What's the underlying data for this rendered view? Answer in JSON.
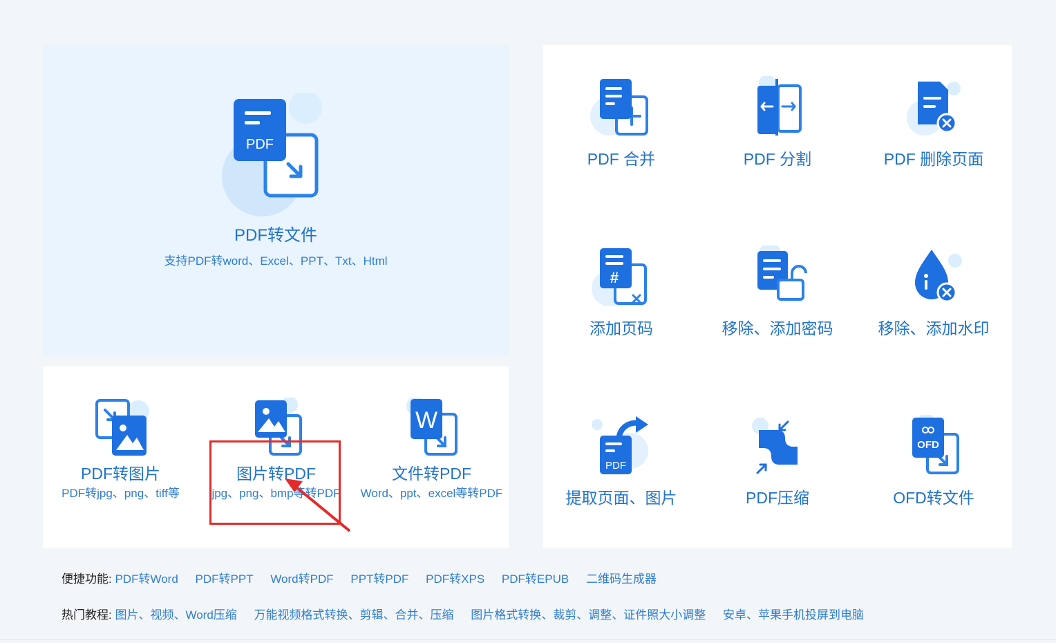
{
  "hero": {
    "icon": "pdf-convert-icon",
    "icon_text": "PDF",
    "title": "PDF转文件",
    "desc": "支持PDF转word、Excel、PPT、Txt、Html"
  },
  "left_tools": [
    {
      "label": "PDF转图片",
      "desc": "PDF转jpg、png、tiff等",
      "icon": "pdf-to-image-icon"
    },
    {
      "label": "图片转PDF",
      "desc": "jpg、png、bmp等转PDF",
      "icon": "image-to-pdf-icon"
    },
    {
      "label": "文件转PDF",
      "desc": "Word、ppt、excel等转PDF",
      "icon": "word-to-pdf-icon",
      "icon_text": "W"
    }
  ],
  "right_tools": [
    {
      "label": "PDF 合并",
      "icon": "pdf-merge-icon"
    },
    {
      "label": "PDF 分割",
      "icon": "pdf-split-icon"
    },
    {
      "label": "PDF 删除页面",
      "icon": "pdf-delete-page-icon"
    },
    {
      "label": "添加页码",
      "icon": "add-page-number-icon",
      "icon_text": "#"
    },
    {
      "label": "移除、添加密码",
      "icon": "password-lock-icon"
    },
    {
      "label": "移除、添加水印",
      "icon": "watermark-drop-icon"
    },
    {
      "label": "提取页面、图片",
      "icon": "extract-page-icon",
      "icon_text": "PDF"
    },
    {
      "label": "PDF压缩",
      "icon": "compress-icon"
    },
    {
      "label": "OFD转文件",
      "icon": "ofd-convert-icon",
      "icon_text": "OFD"
    }
  ],
  "quick_links": {
    "label": "便捷功能:",
    "items": [
      "PDF转Word",
      "PDF转PPT",
      "Word转PDF",
      "PPT转PDF",
      "PDF转XPS",
      "PDF转EPUB",
      "二维码生成器"
    ]
  },
  "tutorials": {
    "label": "热门教程:",
    "items": [
      "图片、视频、Word压缩",
      "万能视频格式转换、剪辑、合并、压缩",
      "图片格式转换、裁剪、调整、证件照大小调整",
      "安卓、苹果手机投屏到电脑"
    ]
  },
  "colors": {
    "accent": "#2f7dd1",
    "icon_blue": "#1e6fe0",
    "annotation": "#e52a2a",
    "hero_bg": "#e9f4fe"
  }
}
